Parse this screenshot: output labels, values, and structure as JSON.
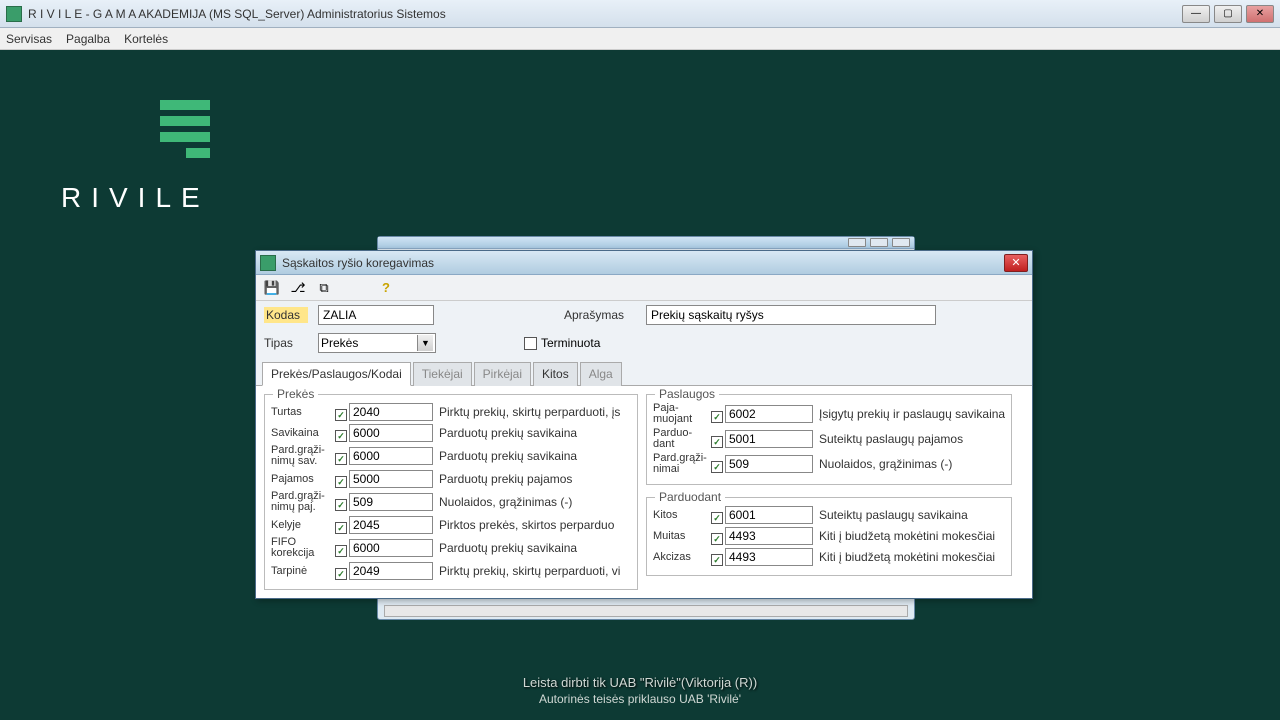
{
  "app": {
    "title": "R I V I L E - G A M A  AKADEMIJA (MS SQL_Server)   Administratorius Sistemos"
  },
  "menu": {
    "servisas": "Servisas",
    "pagalba": "Pagalba",
    "korteles": "Kortelės"
  },
  "logo_text": "RIVILE",
  "dialog": {
    "title": "Sąskaitos ryšio koregavimas",
    "kodas_label": "Kodas",
    "kodas_value": "ZALIA",
    "aprasymas_label": "Aprašymas",
    "aprasymas_value": "Prekių sąskaitų ryšys",
    "tipas_label": "Tipas",
    "tipas_value": "Prekės",
    "terminuota_label": "Terminuota",
    "tabs": {
      "t1": "Prekės/Paslaugos/Kodai",
      "t2": "Tiekėjai",
      "t3": "Pirkėjai",
      "t4": "Kitos",
      "t5": "Alga"
    },
    "groups": {
      "prekes": "Prekės",
      "paslaugos": "Paslaugos",
      "parduodant": "Parduodant"
    },
    "prekes": [
      {
        "label": "Turtas",
        "code": "2040",
        "desc": "Pirktų prekių, skirtų perparduoti, įs"
      },
      {
        "label": "Savikaina",
        "code": "6000",
        "desc": "Parduotų prekių savikaina"
      },
      {
        "label": "Pard.grąži-\nnimų sav.",
        "code": "6000",
        "desc": "Parduotų prekių savikaina"
      },
      {
        "label": "Pajamos",
        "code": "5000",
        "desc": "Parduotų prekių pajamos"
      },
      {
        "label": "Pard.grąži-\nnimų paj.",
        "code": "509",
        "desc": "Nuolaidos, grąžinimas (-)"
      },
      {
        "label": "Kelyje",
        "code": "2045",
        "desc": "Pirktos prekės, skirtos perparduo"
      },
      {
        "label": "FIFO\nkorekcija",
        "code": "6000",
        "desc": "Parduotų prekių savikaina"
      },
      {
        "label": "Tarpinė",
        "code": "2049",
        "desc": "Pirktų prekių, skirtų perparduoti, vi"
      }
    ],
    "paslaugos": [
      {
        "label": "Paja-\nmuojant",
        "code": "6002",
        "desc": "Įsigytų prekių ir paslaugų savikaina"
      },
      {
        "label": "Parduo-\ndant",
        "code": "5001",
        "desc": "Suteiktų paslaugų pajamos"
      },
      {
        "label": "Pard.grąži-\nnimai",
        "code": "509",
        "desc": "Nuolaidos, grąžinimas (-)"
      }
    ],
    "parduodant": [
      {
        "label": "Kitos",
        "code": "6001",
        "desc": "Suteiktų paslaugų savikaina"
      },
      {
        "label": "Muitas",
        "code": "4493",
        "desc": "Kiti į biudžetą mokėtini mokesčiai"
      },
      {
        "label": "Akcizas",
        "code": "4493",
        "desc": "Kiti į biudžetą mokėtini mokesčiai"
      }
    ]
  },
  "footer": {
    "line1": "Leista dirbti tik UAB \"Rivilė\"(Viktorija (R))",
    "line2": "Autorinės teisės priklauso UAB 'Rivilė'"
  }
}
